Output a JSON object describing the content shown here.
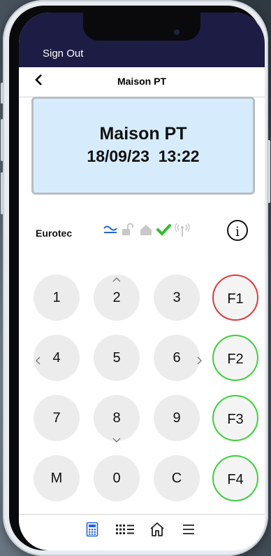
{
  "header": {
    "sign_out": "Sign Out"
  },
  "nav": {
    "back_icon": "chevron-left-icon",
    "title": "Maison PT"
  },
  "display": {
    "title": "Maison PT",
    "date": "18/09/23",
    "time": "13:22"
  },
  "info_bar": {
    "brand": "Eurotec",
    "status_icons": [
      "mains-power-icon",
      "unlocked-icon",
      "home-icon",
      "check-icon",
      "signal-icon"
    ],
    "info_icon": "info-icon"
  },
  "keypad": {
    "keys": [
      "1",
      "2",
      "3",
      "F1",
      "4",
      "5",
      "6",
      "F2",
      "7",
      "8",
      "9",
      "F3",
      "M",
      "0",
      "C",
      "F4"
    ]
  },
  "tabbar": {
    "tabs": [
      "keypad-icon",
      "zones-list-icon",
      "home-icon",
      "menu-icon"
    ]
  },
  "colors": {
    "header_bg": "#1c1c44",
    "display_bg": "#d6ecfc",
    "accent_blue": "#2463d6",
    "ok_green": "#2fbf2f",
    "f1_border": "#e23a3a",
    "f_border": "#3ed13e"
  }
}
